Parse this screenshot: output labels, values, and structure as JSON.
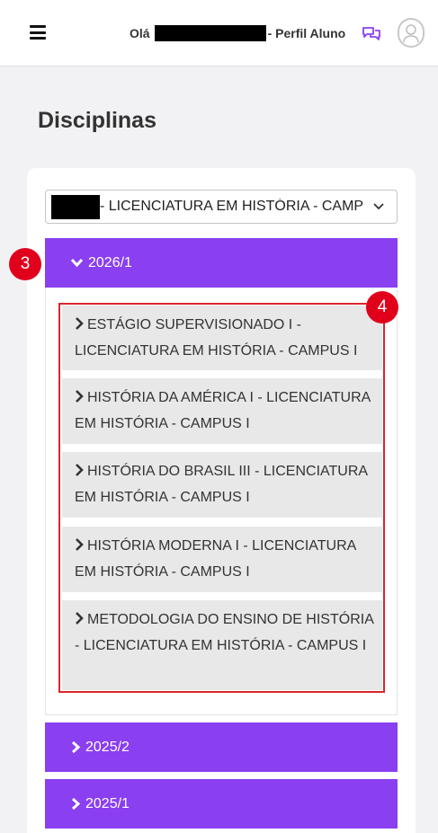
{
  "header": {
    "greeting_prefix": "Olá",
    "greeting_suffix": "- Perfil Aluno",
    "menu_icon": "hamburger-icon",
    "chat_icon": "chat-icon",
    "avatar_icon": "user-avatar-icon",
    "accent_color": "#8a3ff0"
  },
  "page": {
    "title": "Disciplinas"
  },
  "course_select": {
    "selected": "- LICENCIATURA EM HISTÓRIA - CAMPUS I"
  },
  "semesters": [
    {
      "label": "2026/1",
      "expanded": true,
      "disciplines": [
        "ESTÁGIO SUPERVISIONADO I - LICENCIATURA EM HISTÓRIA - CAMPUS I",
        "HISTÓRIA DA AMÉRICA I - LICENCIATURA EM HISTÓRIA - CAMPUS I",
        "HISTÓRIA DO BRASIL III - LICENCIATURA EM HISTÓRIA - CAMPUS I",
        "HISTÓRIA MODERNA I - LICENCIATURA EM HISTÓRIA - CAMPUS I",
        "METODOLOGIA DO ENSINO DE HISTÓRIA - LICENCIATURA EM HISTÓRIA - CAMPUS I"
      ]
    },
    {
      "label": "2025/2",
      "expanded": false
    },
    {
      "label": "2025/1",
      "expanded": false
    }
  ],
  "annotations": {
    "badge_semester": "3",
    "badge_disciplines": "4"
  }
}
